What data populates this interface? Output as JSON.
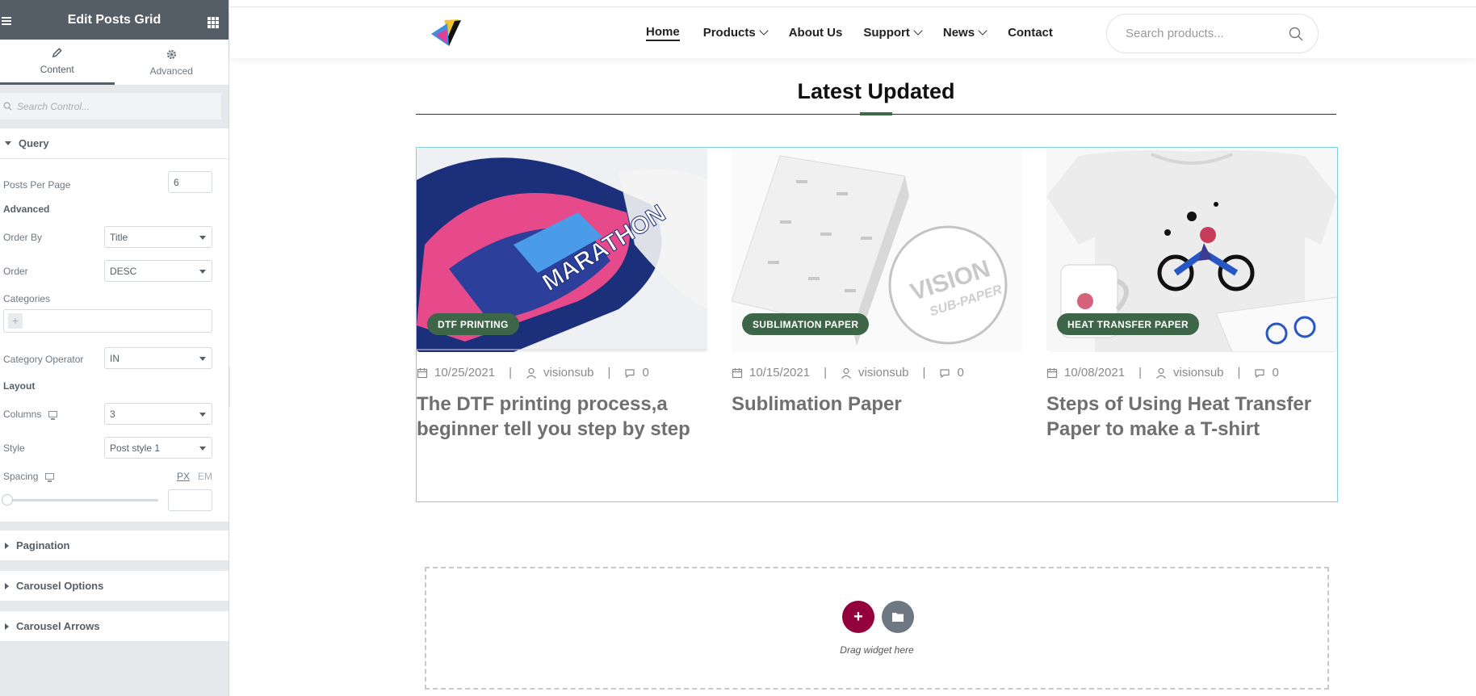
{
  "editor": {
    "title": "Edit Posts Grid",
    "tabs": [
      {
        "label": "Content"
      },
      {
        "label": "Advanced"
      }
    ],
    "search_placeholder": "Search Control...",
    "query": {
      "title": "Query",
      "posts_per_page_label": "Posts Per Page",
      "posts_per_page_value": "6",
      "advanced_heading": "Advanced",
      "order_by_label": "Order By",
      "order_by_value": "Title",
      "order_label": "Order",
      "order_value": "DESC",
      "categories_label": "Categories",
      "category_operator_label": "Category Operator",
      "category_operator_value": "IN",
      "layout_heading": "Layout",
      "columns_label": "Columns",
      "columns_value": "3",
      "style_label": "Style",
      "style_value": "Post style 1",
      "spacing_label": "Spacing",
      "unit_px": "PX",
      "unit_em": "EM",
      "spacing_value": ""
    },
    "sections": [
      {
        "label": "Pagination"
      },
      {
        "label": "Carousel Options"
      },
      {
        "label": "Carousel Arrows"
      }
    ]
  },
  "site": {
    "nav": [
      {
        "label": "Home"
      },
      {
        "label": "Products"
      },
      {
        "label": "About Us"
      },
      {
        "label": "Support"
      },
      {
        "label": "News"
      },
      {
        "label": "Contact"
      }
    ],
    "search_placeholder": "Search products...",
    "section_title": "Latest Updated",
    "posts": [
      {
        "category": "DTF PRINTING",
        "date": "10/25/2021",
        "author": "visionsub",
        "comments": "0",
        "title": "The DTF printing process,a beginner tell you step by step"
      },
      {
        "category": "SUBLIMATION PAPER",
        "date": "10/15/2021",
        "author": "visionsub",
        "comments": "0",
        "title": "Sublimation Paper"
      },
      {
        "category": "HEAT TRANSFER PAPER",
        "date": "10/08/2021",
        "author": "visionsub",
        "comments": "0",
        "title": "Steps of Using Heat Transfer Paper to make a T-shirt"
      }
    ],
    "thumb_texts": {
      "marathon": "MARATHON",
      "vision": "VISION",
      "sub_paper": "SUB-PAPER"
    },
    "drop_zone_text": "Drag widget here",
    "meta_separator": "|"
  }
}
